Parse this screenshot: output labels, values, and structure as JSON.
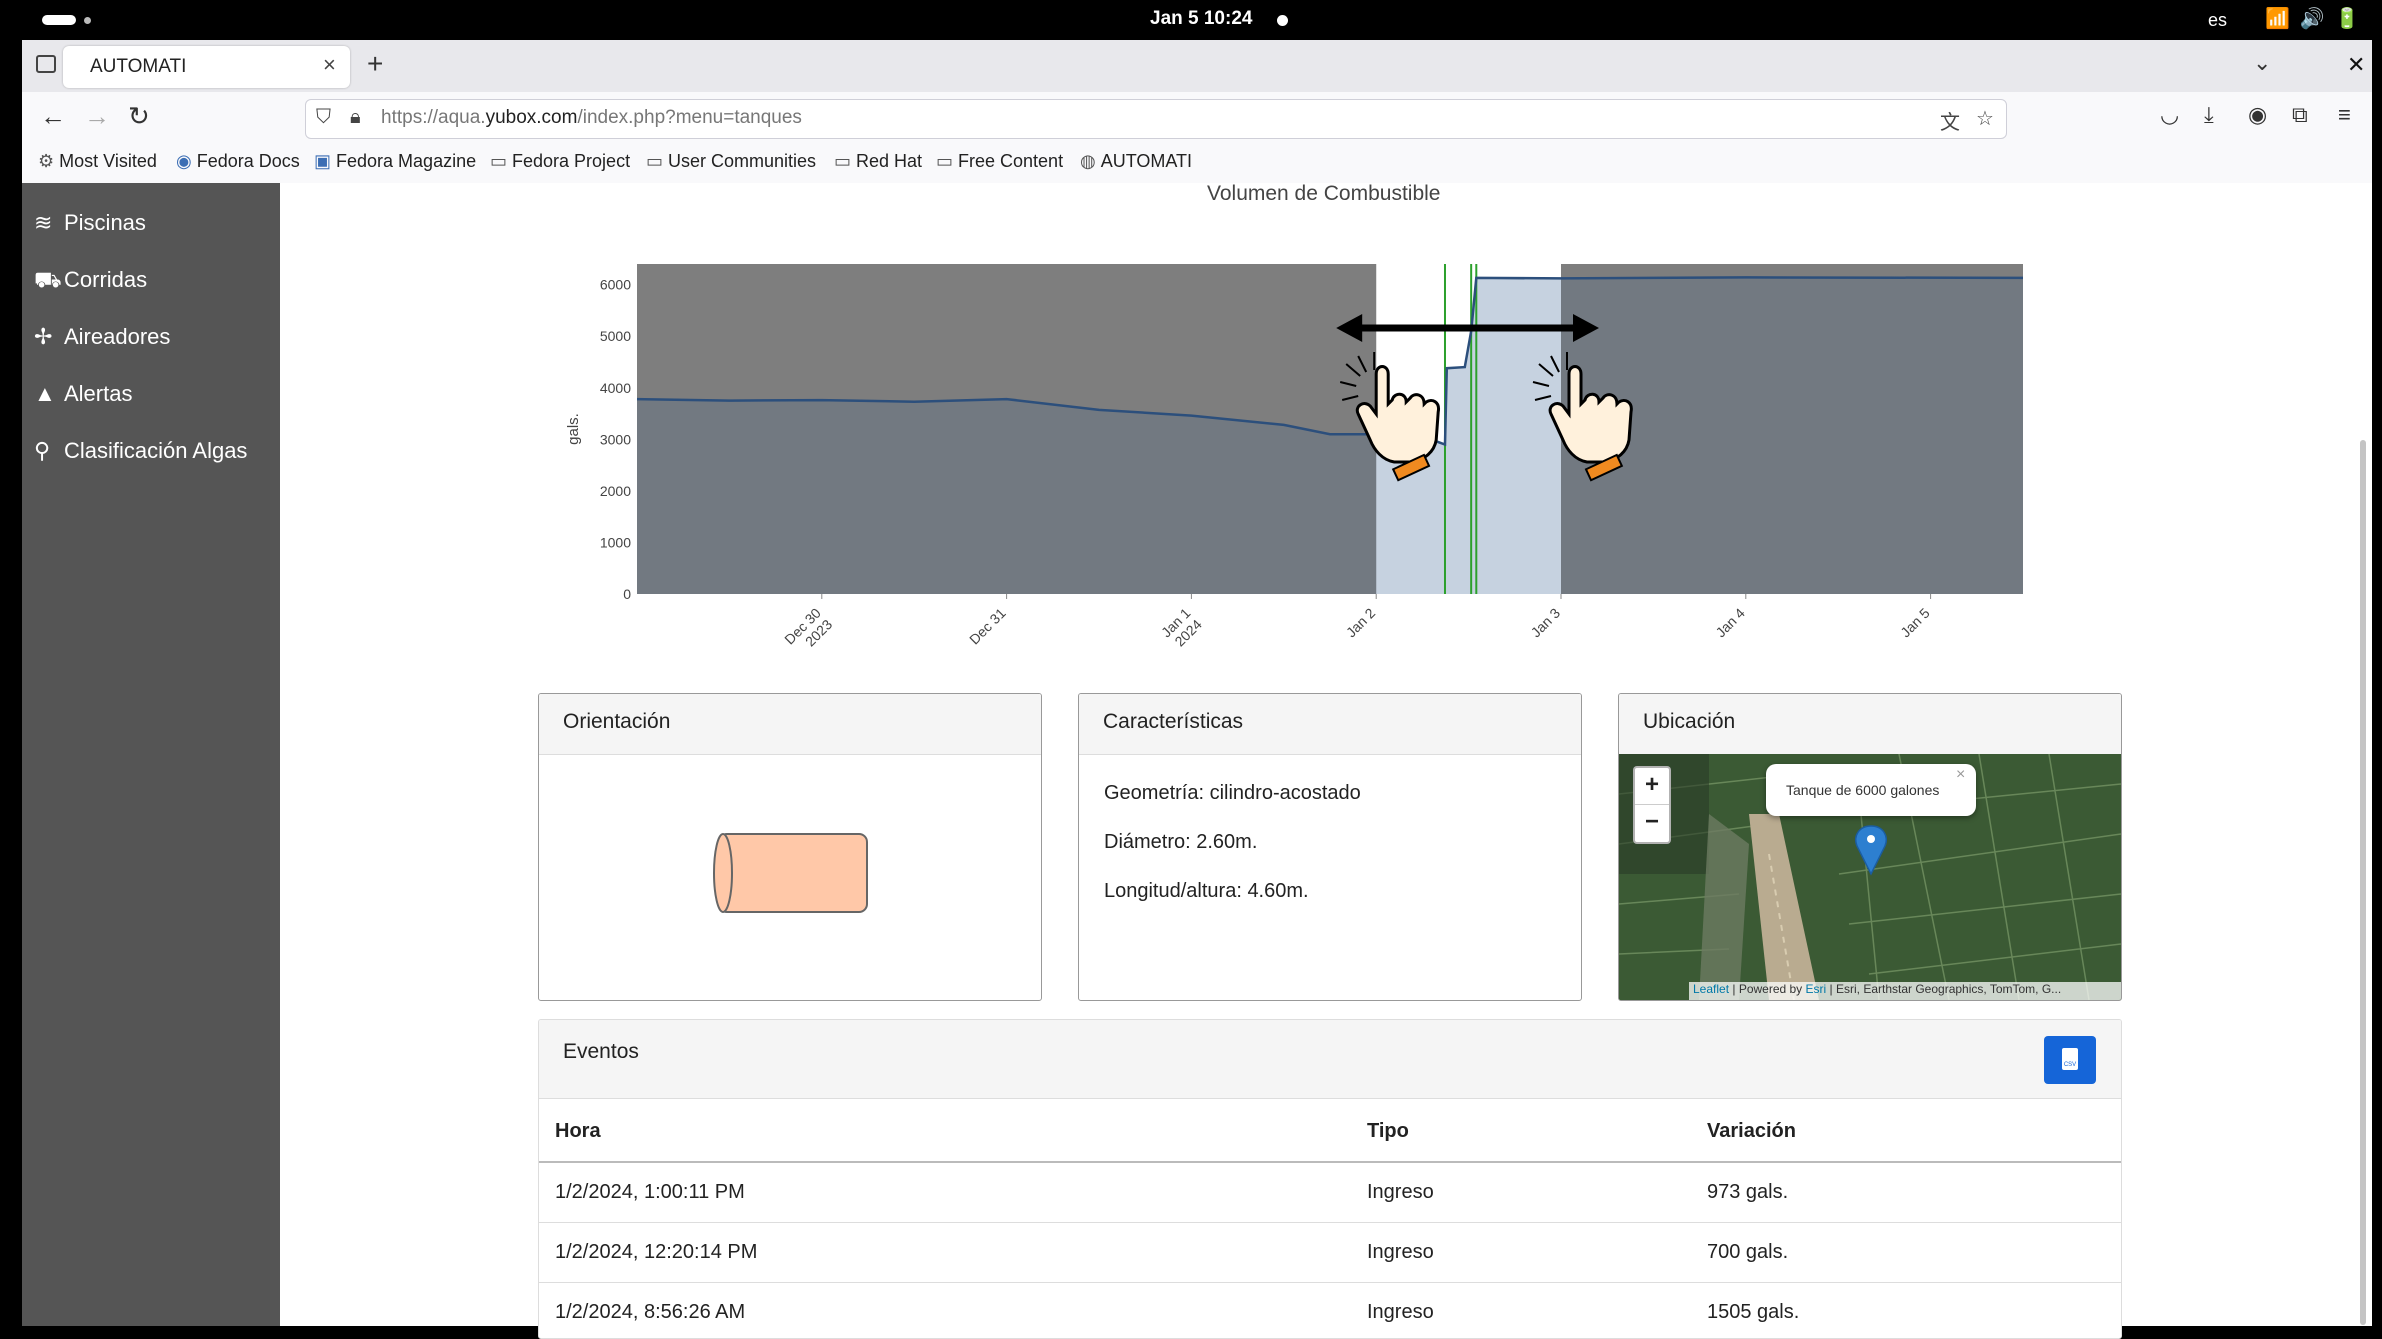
{
  "system": {
    "clock": "Jan 5  10:24",
    "lang": "es"
  },
  "browser": {
    "tab_title": "AUTOMATI",
    "url_prefix": "https://aqua.",
    "url_domain": "yubox.com",
    "url_path": "/index.php?menu=tanques",
    "bookmarks": [
      "Most Visited",
      "Fedora Docs",
      "Fedora Magazine",
      "Fedora Project",
      "User Communities",
      "Red Hat",
      "Free Content",
      "AUTOMATI"
    ]
  },
  "sidebar": {
    "items": [
      {
        "label": "Piscinas",
        "icon": "waves-icon"
      },
      {
        "label": "Corridas",
        "icon": "fish-icon"
      },
      {
        "label": "Aireadores",
        "icon": "fan-icon"
      },
      {
        "label": "Alertas",
        "icon": "bell-icon"
      },
      {
        "label": "Clasificación Algas",
        "icon": "microscope-icon"
      }
    ]
  },
  "chart_title": "Volumen de Combustible",
  "chart_data": {
    "type": "line",
    "title": "Volumen de Combustible",
    "ylabel": "gals.",
    "ylim": [
      0,
      6400
    ],
    "yticks": [
      0,
      1000,
      2000,
      3000,
      4000,
      5000,
      6000
    ],
    "xticks": [
      "Dec 30\n2023",
      "Dec 31",
      "Jan 1\n2024",
      "Jan 2",
      "Jan 3",
      "Jan 4",
      "Jan 5"
    ],
    "x_range": [
      "2023-12-29",
      "2024-01-05 12:00"
    ],
    "selection_range": [
      "2024-01-02",
      "2024-01-03"
    ],
    "event_markers": [
      "2024-01-02 08:56",
      "2024-01-02 12:20",
      "2024-01-02 13:00"
    ],
    "series": [
      {
        "color": "#2c4f7c",
        "points": [
          [
            "2023-12-29 00:00",
            3780
          ],
          [
            "2023-12-29 12:00",
            3750
          ],
          [
            "2023-12-30 00:00",
            3760
          ],
          [
            "2023-12-30 12:00",
            3730
          ],
          [
            "2023-12-31 00:00",
            3780
          ],
          [
            "2023-12-31 12:00",
            3570
          ],
          [
            "2024-01-01 00:00",
            3460
          ],
          [
            "2024-01-01 12:00",
            3280
          ],
          [
            "2024-01-01 18:00",
            3100
          ],
          [
            "2024-01-02 00:00",
            3100
          ],
          [
            "2024-01-02 08:00",
            2950
          ],
          [
            "2024-01-02 08:56",
            2900
          ],
          [
            "2024-01-02 09:10",
            4380
          ],
          [
            "2024-01-02 11:30",
            4400
          ],
          [
            "2024-01-02 12:20",
            5100
          ],
          [
            "2024-01-02 13:00",
            6130
          ],
          [
            "2024-01-03 00:00",
            6120
          ],
          [
            "2024-01-04 00:00",
            6140
          ],
          [
            "2024-01-05 12:00",
            6130
          ]
        ]
      }
    ]
  },
  "panels": {
    "orientacion": {
      "title": "Orientación"
    },
    "caracteristicas": {
      "title": "Características",
      "lines": [
        "Geometría: cilindro-acostado",
        "Diámetro: 2.60m.",
        "Longitud/altura: 4.60m."
      ]
    },
    "ubicacion": {
      "title": "Ubicación",
      "zoom_in": "+",
      "zoom_out": "−",
      "popup": "Tanque de 6000 galones",
      "popup_close": "×",
      "attribution_leaflet": "Leaflet",
      "attribution_mid": " | Powered by ",
      "attribution_esri": "Esri",
      "attribution_rest": " | Esri, Earthstar Geographics, TomTom, G..."
    }
  },
  "eventos": {
    "title": "Eventos",
    "columns": [
      "Hora",
      "Tipo",
      "Variación"
    ],
    "rows": [
      [
        "1/2/2024, 1:00:11 PM",
        "Ingreso",
        "973 gals."
      ],
      [
        "1/2/2024, 12:20:14 PM",
        "Ingreso",
        "700 gals."
      ],
      [
        "1/2/2024, 8:56:26 AM",
        "Ingreso",
        "1505 gals."
      ]
    ]
  }
}
